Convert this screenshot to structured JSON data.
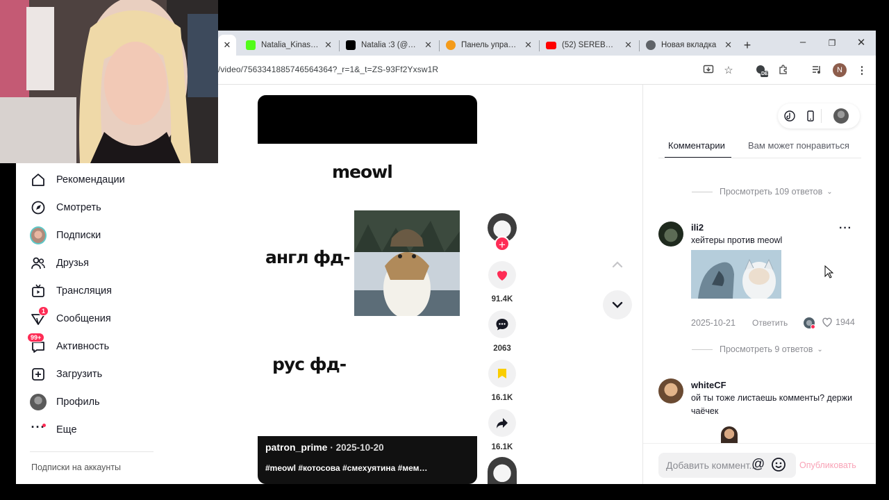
{
  "browser": {
    "tabs": [
      {
        "title": "Natalia_Kinasli S",
        "color": "#53fc18",
        "active": false
      },
      {
        "title": "Natalia :3 (@nat",
        "color": "#000000",
        "active": false
      },
      {
        "title": "Панель управле",
        "color": "#f49b1a",
        "active": false
      },
      {
        "title": "(52) SEREBROoffi",
        "color": "#ff0000",
        "active": false
      },
      {
        "title": "Новая вкладка",
        "color": "#5f6368",
        "active": false
      }
    ],
    "new_tab": "+",
    "url": "/video/7563341885746564364?_r=1&_t=ZS-93Ff2Yxsw1R",
    "profile_initial": "N",
    "ext_badge": "DE"
  },
  "sidebar": {
    "items": [
      {
        "label": "Рекомендации",
        "icon": "home-icon"
      },
      {
        "label": "Смотреть",
        "icon": "compass-icon"
      },
      {
        "label": "Подписки",
        "icon": "following-avatar-icon"
      },
      {
        "label": "Друзья",
        "icon": "friends-icon"
      },
      {
        "label": "Трансляция",
        "icon": "live-tv-icon"
      },
      {
        "label": "Сообщения",
        "icon": "send-icon",
        "badge": "1"
      },
      {
        "label": "Активность",
        "icon": "activity-icon",
        "badge": "99+"
      },
      {
        "label": "Загрузить",
        "icon": "upload-icon"
      },
      {
        "label": "Профиль",
        "icon": "profile-avatar-icon"
      },
      {
        "label": "Еще",
        "icon": "more-dots-icon"
      }
    ],
    "footer": "Подписки на аккаунты"
  },
  "video": {
    "text_top": "meowl",
    "text_mid": "англ фд-",
    "text_bottom": "рус фд-",
    "author": "patron_prime",
    "date": "· 2025-10-20",
    "hashtags": "#meowl #котосова #смехуятина #мем…"
  },
  "actions": {
    "likes": "91.4K",
    "comments": "2063",
    "saves": "16.1K",
    "shares": "16.1K"
  },
  "right_panel": {
    "tabs": [
      "Комментарии",
      "Вам может понравиться"
    ],
    "view_replies_1": "Просмотреть 109 ответов",
    "comment1": {
      "user": "ili2",
      "text": "хейтеры против meowl",
      "date": "2025-10-21",
      "reply": "Ответить",
      "likes": "1944"
    },
    "view_replies_2": "Просмотреть 9 ответов",
    "comment2": {
      "user": "whiteCF",
      "text_line1": "ой ты тоже листаешь комменты? держи",
      "text_line2": "чаёчек"
    },
    "input_placeholder": "Добавить коммент...",
    "post_button": "Опубликовать"
  }
}
